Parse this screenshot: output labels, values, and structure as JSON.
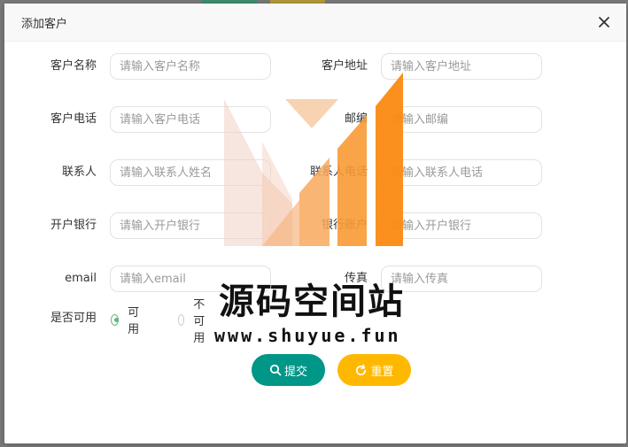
{
  "dialog": {
    "title": "添加客户"
  },
  "form": {
    "fields": [
      {
        "label": "客户名称",
        "placeholder": "请输入客户名称"
      },
      {
        "label": "客户地址",
        "placeholder": "请输入客户地址"
      },
      {
        "label": "客户电话",
        "placeholder": "请输入客户电话"
      },
      {
        "label": "邮编",
        "placeholder": "请输入邮编"
      },
      {
        "label": "联系人",
        "placeholder": "请输入联系人姓名"
      },
      {
        "label": "联系人电话",
        "placeholder": "请输入联系人电话"
      },
      {
        "label": "开户银行",
        "placeholder": "请输入开户银行"
      },
      {
        "label": "银行账户",
        "placeholder": "请输入开户银行"
      },
      {
        "label": "email",
        "placeholder": "请输入email"
      },
      {
        "label": "传真",
        "placeholder": "请输入传真"
      }
    ],
    "available": {
      "label": "是否可用",
      "options": [
        {
          "label": "可用",
          "checked": true
        },
        {
          "label": "不可用",
          "checked": false
        }
      ]
    },
    "submit_label": "提交",
    "reset_label": "重置"
  },
  "watermark": {
    "title": "源码空间站",
    "url": "www.shuyue.fun"
  },
  "colors": {
    "submit": "#009688",
    "reset": "#ffb800",
    "radio_checked": "#5fb878"
  },
  "icons": {
    "close": "close-icon",
    "submit": "search-icon",
    "reset": "refresh-icon"
  }
}
